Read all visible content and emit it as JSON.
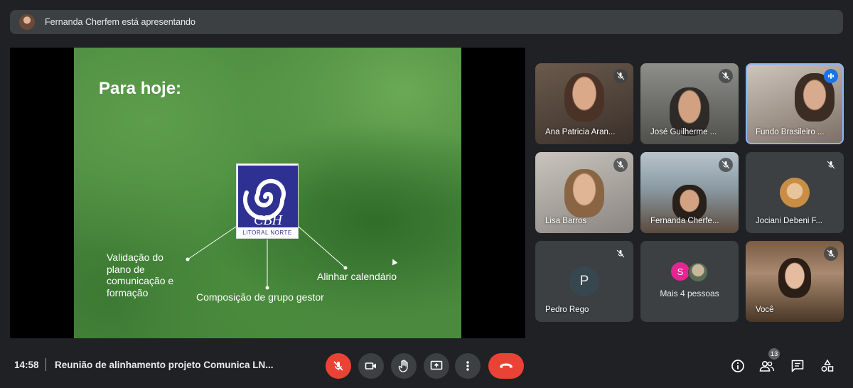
{
  "presenting_banner": {
    "text": "Fernanda Cherfem está apresentando"
  },
  "slide": {
    "title": "Para hoje:",
    "logo": {
      "letters": "CBH",
      "subtitle": "LITORAL NORTE"
    },
    "items": [
      "Validação do\nplano de\ncomunicação e\nformação",
      "Composição de grupo gestor",
      "Alinhar calendário"
    ]
  },
  "participants": [
    {
      "name": "Ana Patricia Aran...",
      "muted": true,
      "speaking": false
    },
    {
      "name": "José Guilherme ...",
      "muted": true,
      "speaking": false
    },
    {
      "name": "Fundo Brasileiro ...",
      "muted": false,
      "speaking": true
    },
    {
      "name": "Lisa Barros",
      "muted": true,
      "speaking": false
    },
    {
      "name": "Fernanda Cherfe...",
      "muted": true,
      "speaking": false
    },
    {
      "name": "Jociani Debeni F...",
      "muted": true,
      "speaking": false
    },
    {
      "name": "Pedro Rego",
      "initial": "P",
      "muted": true,
      "speaking": false
    },
    {
      "label": "Mais 4 pessoas",
      "initial": "S"
    },
    {
      "name": "Você",
      "muted": true,
      "speaking": false
    }
  ],
  "meeting": {
    "time": "14:58",
    "title": "Reunião de alinhamento projeto Comunica LN..."
  },
  "controls": [
    "mic-off",
    "camera",
    "raise-hand",
    "present-screen",
    "more-options",
    "end-call"
  ],
  "right_controls": [
    "info",
    "people",
    "chat",
    "activities"
  ],
  "people_count": "13",
  "colors": {
    "accent_red": "#ea4335",
    "speaking_blue": "#1a73e8",
    "tile_bg": "#3c4043",
    "page_bg": "#202124"
  }
}
